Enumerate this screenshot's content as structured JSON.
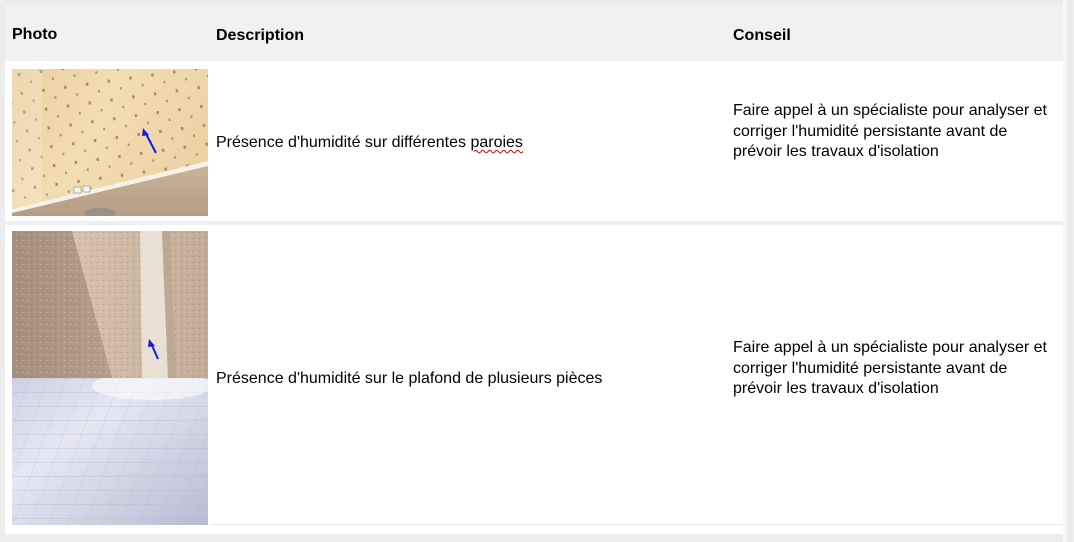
{
  "table": {
    "headers": {
      "photo": "Photo",
      "description": "Description",
      "advice": "Conseil"
    },
    "rows": [
      {
        "description_main": "Présence d'humidité sur différentes ",
        "description_flagged_word": "paroies",
        "advice": "Faire appel à un spécialiste pour analyser et corriger l'humidité persistante avant de prévoir les travaux d'isolation",
        "photos": [
          "wall-with-humidity-arrow"
        ]
      },
      {
        "description": "Présence d'humidité sur le plafond de plusieurs pièces",
        "advice": "Faire appel à un spécialiste pour analyser et corriger l'humidité persistante avant de prévoir les travaux d'isolation",
        "photos": [
          "ceiling-corner-with-humidity-arrow",
          "ceiling-tiles"
        ]
      }
    ]
  },
  "colors": {
    "page_background": "#ececec",
    "header_background": "#f1f1f1",
    "arrow": "#1a1adb",
    "spellcheck_underline": "#d40000"
  }
}
